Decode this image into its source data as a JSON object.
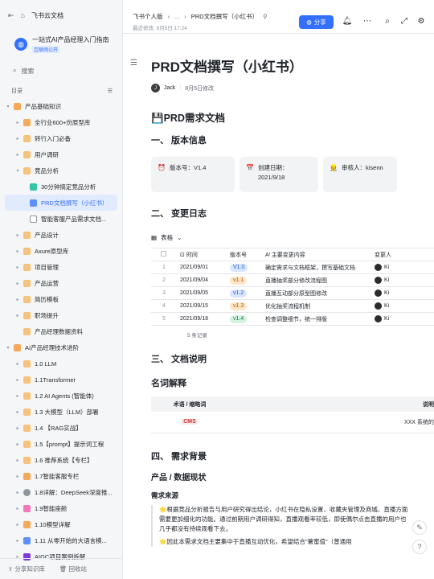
{
  "sidebar": {
    "brand": "飞书云文档",
    "workspace_name": "一站式AI产品经理入门指南",
    "workspace_badge": "互联网公开",
    "search_placeholder": "搜索",
    "toc_label": "目录",
    "items": [
      {
        "label": "产品基础知识",
        "arrow": "▾",
        "icon": "hand-icon",
        "color": "orange"
      },
      {
        "label": "全行业600+份原型库",
        "arrow": "▸",
        "icon": "hand-icon",
        "color": "orange"
      },
      {
        "label": "转行入门必备",
        "arrow": "▸",
        "icon": "folder-icon",
        "color": "folder"
      },
      {
        "label": "用户调研",
        "arrow": "▸",
        "icon": "folder-icon",
        "color": "folder"
      },
      {
        "label": "竞品分析",
        "arrow": "▾",
        "icon": "folder-icon",
        "color": "folder"
      },
      {
        "label": "30分钟搞定竞品分析",
        "arrow": "",
        "icon": "sheet-icon",
        "color": "green"
      },
      {
        "label": "PRD文档撰写（小红书）",
        "arrow": "",
        "icon": "doc-icon",
        "color": "blue",
        "active": true
      },
      {
        "label": "智能客服产品需求文档...",
        "arrow": "",
        "icon": "doc-icon",
        "color": "doc"
      },
      {
        "label": "产品设计",
        "arrow": "▸",
        "icon": "folder-icon",
        "color": "folder"
      },
      {
        "label": "Axure原型库",
        "arrow": "▸",
        "icon": "folder-icon",
        "color": "folder"
      },
      {
        "label": "项目管理",
        "arrow": "▸",
        "icon": "folder-icon",
        "color": "folder"
      },
      {
        "label": "产品运营",
        "arrow": "▸",
        "icon": "folder-icon",
        "color": "folder"
      },
      {
        "label": "简历模板",
        "arrow": "▸",
        "icon": "folder-icon",
        "color": "folder"
      },
      {
        "label": "职场提升",
        "arrow": "▸",
        "icon": "folder-icon",
        "color": "folder"
      },
      {
        "label": "产品经理数据资料",
        "arrow": "",
        "icon": "folder-icon",
        "color": "folder"
      },
      {
        "label": "AI产品经理技术进阶",
        "arrow": "▾",
        "icon": "hand-icon",
        "color": "orange"
      },
      {
        "label": "1.0 LLM",
        "arrow": "▸",
        "icon": "folder-icon",
        "color": "folder"
      },
      {
        "label": "1.1Transformer",
        "arrow": "▸",
        "icon": "folder-icon",
        "color": "folder"
      },
      {
        "label": "1.2 AI Agents (智能体)",
        "arrow": "▸",
        "icon": "folder-icon",
        "color": "folder"
      },
      {
        "label": "1.3 大模型（LLM）部署",
        "arrow": "▸",
        "icon": "folder-icon",
        "color": "folder"
      },
      {
        "label": "1.4 【RAG实战】",
        "arrow": "▸",
        "icon": "folder-icon",
        "color": "folder"
      },
      {
        "label": "1.5【prompt】提示词工程",
        "arrow": "▸",
        "icon": "folder-icon",
        "color": "folder"
      },
      {
        "label": "1.6 推荐系统【专栏】",
        "arrow": "▸",
        "icon": "folder-icon",
        "color": "folder"
      },
      {
        "label": "1.7智能客服专栏",
        "arrow": "▸",
        "icon": "hand-icon",
        "color": "orange"
      },
      {
        "label": "1.8详解：DeepSeek深度推...",
        "arrow": "▸",
        "icon": "gear-icon",
        "color": "gear"
      },
      {
        "label": "1.9智能座舱",
        "arrow": "▸",
        "icon": "car-icon",
        "color": "pink"
      },
      {
        "label": "1.10模型详解",
        "arrow": "▸",
        "icon": "hand-icon",
        "color": "orange"
      },
      {
        "label": "1.11 从零开始的大语言模...",
        "arrow": "▸",
        "icon": "books-icon",
        "color": "blue"
      },
      {
        "label": "AIGC项目案例拆解",
        "arrow": "▸",
        "icon": "disk-icon",
        "color": "purple"
      }
    ],
    "bottom": {
      "knowledge_label": "分享知识库",
      "trash_label": "回收站"
    }
  },
  "header": {
    "crumb_1": "飞书个人版",
    "crumb_sep": "...",
    "crumb_doc": "PRD文档撰写（小红书）",
    "modified": "最近修改: 8月5日 17:24",
    "share_label": "分享"
  },
  "doc": {
    "title": "PRD文档撰写（小红书）",
    "author": "Jack",
    "author_initial": "J",
    "modified": "8月5日修改",
    "h_main": "💾PRD需求文档",
    "sec1": "一、 版本信息",
    "callouts": [
      {
        "icon": "⏰",
        "text": "版本号：V1.4"
      },
      {
        "icon": "📅",
        "text": "创建日期：2021/9/18"
      },
      {
        "icon": "👷",
        "text": "审核人：kisenn"
      }
    ],
    "sec2": "二、 变更日志",
    "table_label": "表格",
    "changes": {
      "headers": [
        "",
        "时间",
        "版本号",
        "主要变更内容",
        "变更人"
      ],
      "rows": [
        {
          "n": "1",
          "date": "2021/09/01",
          "ver": "V1.0",
          "tag": "blue",
          "content": "确定需求与文档框架，撰写基础文档",
          "who": "Ki"
        },
        {
          "n": "2",
          "date": "2021/09/04",
          "ver": "v1.1",
          "tag": "orange",
          "content": "直播抽奖部分修改流程图",
          "who": "Ki"
        },
        {
          "n": "3",
          "date": "2021/09/05",
          "ver": "v1.2",
          "tag": "blue",
          "content": "直播互动部分原型图修改",
          "who": "Ki"
        },
        {
          "n": "4",
          "date": "2021/09/15",
          "ver": "v1.3",
          "tag": "orange",
          "content": "优化抽奖流程机制",
          "who": "Ki"
        },
        {
          "n": "5",
          "date": "2021/09/18",
          "ver": "v1.4",
          "tag": "green",
          "content": "检查调整细节，统一排版",
          "who": "Ki"
        }
      ],
      "count": "5 条记录"
    },
    "sec3": "三、 文档说明",
    "sub_terms": "名词解释",
    "terms": {
      "headers": [
        "术语 / 缩略词",
        "说明"
      ],
      "rows": [
        {
          "term": "CMS",
          "desc": "XXX 系统的"
        }
      ]
    },
    "sec4": "四、 需求背景",
    "sub_product": "产品 / 数据现状",
    "sub_source": "需求来源",
    "para1": "🌟根据竞品分析报告与用户研究得出结论，小红书在隐私设置、收藏夹管理及商城、直播方面需要更加细化的功能。通过前期用户调研得知，直播观看率较低，即使偶尔点击直播的用户也几乎都没有持续观看下去。",
    "para2": "🌟因此本需求文档主要集中于直播互动优化，希望结合\"薯蜜值\"（普通用"
  }
}
